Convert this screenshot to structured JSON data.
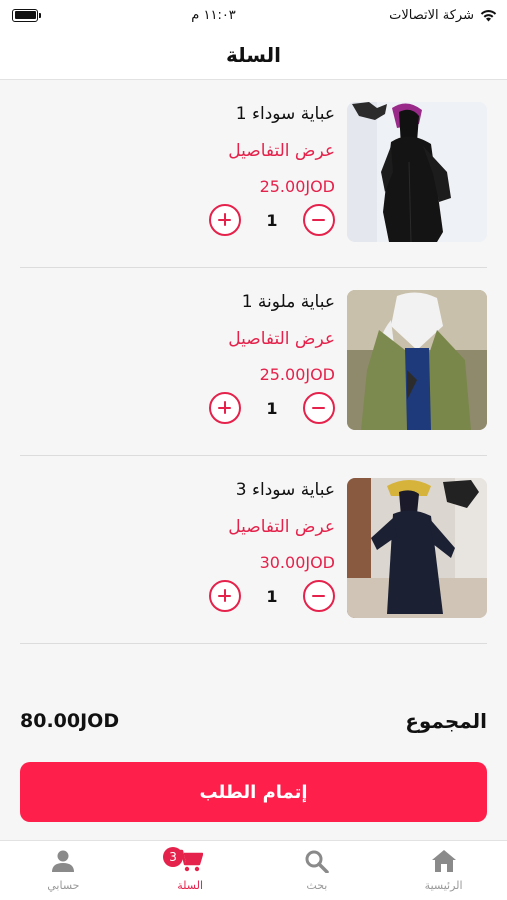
{
  "status_bar": {
    "time": "١١:٠٣ م",
    "carrier": "شركة الاتصالات"
  },
  "header": {
    "title": "السلة"
  },
  "cart_items": [
    {
      "name": "عباية سوداء 1",
      "details_label": "عرض التفاصيل",
      "price": "25.00JOD",
      "quantity": "1",
      "image": "black-abaya-purple-veil"
    },
    {
      "name": "عباية ملونة 1",
      "details_label": "عرض التفاصيل",
      "price": "25.00JOD",
      "quantity": "1",
      "image": "green-abaya-white-scarf"
    },
    {
      "name": "عباية سوداء 3",
      "details_label": "عرض التفاصيل",
      "price": "30.00JOD",
      "quantity": "1",
      "image": "navy-abaya-yellow-hat"
    }
  ],
  "summary": {
    "total_label": "المجموع",
    "total_value": "80.00JOD"
  },
  "checkout": {
    "label": "إتمام الطلب"
  },
  "tabs": [
    {
      "label": "الرئيسية",
      "icon": "home-icon",
      "active": false
    },
    {
      "label": "بحث",
      "icon": "search-icon",
      "active": false
    },
    {
      "label": "السلة",
      "icon": "cart-icon",
      "active": true,
      "badge": "3"
    },
    {
      "label": "حسابي",
      "icon": "person-icon",
      "active": false
    }
  ],
  "colors": {
    "accent": "#e5224b",
    "button": "#ff1f4b",
    "background": "#f6f6f6"
  }
}
